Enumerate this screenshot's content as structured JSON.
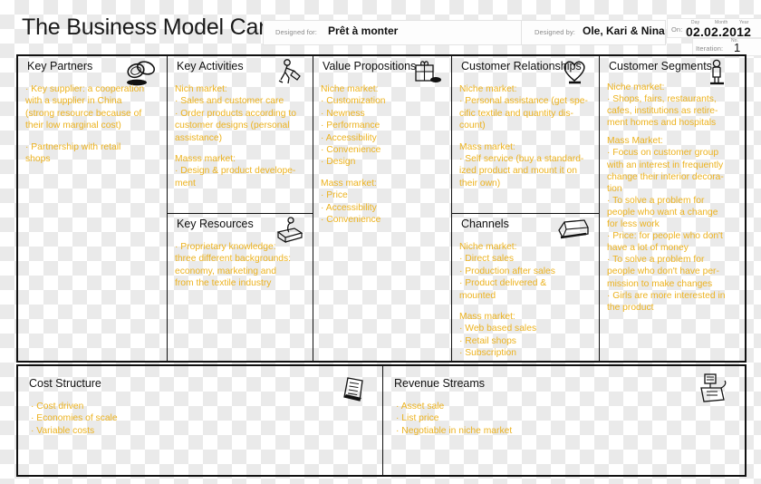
{
  "header": {
    "title": "The Business Model Canvas",
    "designed_for_label": "Designed for:",
    "designed_for_value": "Prêt à monter",
    "designed_by_label": "Designed by:",
    "designed_by_value": "Ole, Kari & Nina",
    "on_label": "On:",
    "day_label": "Day",
    "month_label": "Month",
    "year_label": "Year",
    "date_value": "02.02.2012",
    "iteration_label": "Iteration:",
    "no_label": "No.",
    "iteration_value": "1"
  },
  "colors": {
    "text_orange": "#ecb21f",
    "title_black": "#111111",
    "border": "#111111"
  },
  "blocks": {
    "key_partners": {
      "title": "Key Partners",
      "icon": "linked-rings-icon",
      "lines": [
        "· Key supplier: a cooperation",
        "with a supplier in China",
        "(strong resource because of",
        "their low marginal cost)",
        "",
        "· Partnership with retail",
        "shops"
      ]
    },
    "key_activities": {
      "title": "Key Activities",
      "icon": "worker-icon",
      "lines": [
        "Nich market:",
        "· Sales and customer care",
        "· Order products according to",
        "customer designs (personal",
        "assistance)",
        "",
        "Masss market:",
        "· Design & product develope-",
        "ment"
      ]
    },
    "key_resources": {
      "title": "Key Resources",
      "icon": "person-on-machine-icon",
      "lines": [
        "· Proprietary knowledge:",
        "three different backgrounds:",
        "economy, marketing and",
        "from the textile industry"
      ]
    },
    "value_propositions": {
      "title": "Value Propositions",
      "icon": "gift-package-icon",
      "lines": [
        "Niche market:",
        "· Customization",
        "· Newness",
        "· Performance",
        "· Accessibility",
        "· Convenience",
        "· Design",
        "",
        "Mass market:",
        "· Price",
        "· Accessibility",
        "· Convenience"
      ]
    },
    "customer_relationships": {
      "title": "Customer Relationships",
      "icon": "heart-icon",
      "lines": [
        "Niche market:",
        "· Personal assistance (get spe-",
        "cific textile and quantity dis-",
        "count)",
        "",
        "Mass market:",
        "· Self service (buy a standard-",
        "ized product and mount it on",
        "their own)"
      ]
    },
    "channels": {
      "title": "Channels",
      "icon": "delivery-truck-icon",
      "lines": [
        "Niche market:",
        "· Direct sales",
        "· Production after sales",
        "· Product delivered &",
        "mounted",
        "",
        "Mass market:",
        "· Web based sales",
        "· Retail shops",
        "· Subscription"
      ]
    },
    "customer_segments": {
      "title": "Customer Segments",
      "icon": "person-standing-icon",
      "lines": [
        "Niche market:",
        "· Shops, fairs, restaurants,",
        "cafes, institutions as retire-",
        "ment homes and hospitals",
        "",
        "Mass Market:",
        "· Focus on customer group",
        "with an interest in frequently",
        "change their interior decora-",
        "tion",
        "· To solve a problem for",
        "people who want a change",
        "for less work",
        "· Price: for people who don't",
        "have a lot of money",
        "· To solve a problem for",
        "people who don't have per-",
        "mission to make changes",
        "· Girls are more interested in",
        "the product"
      ]
    },
    "cost_structure": {
      "title": "Cost Structure",
      "icon": "invoice-sheet-icon",
      "lines": [
        "· Cost driven",
        "· Economies of scale",
        "· Variable costs"
      ]
    },
    "revenue_streams": {
      "title": "Revenue Streams",
      "icon": "cash-register-icon",
      "lines": [
        "· Asset sale",
        "· List price",
        "· Negotiable in niche market"
      ]
    }
  }
}
